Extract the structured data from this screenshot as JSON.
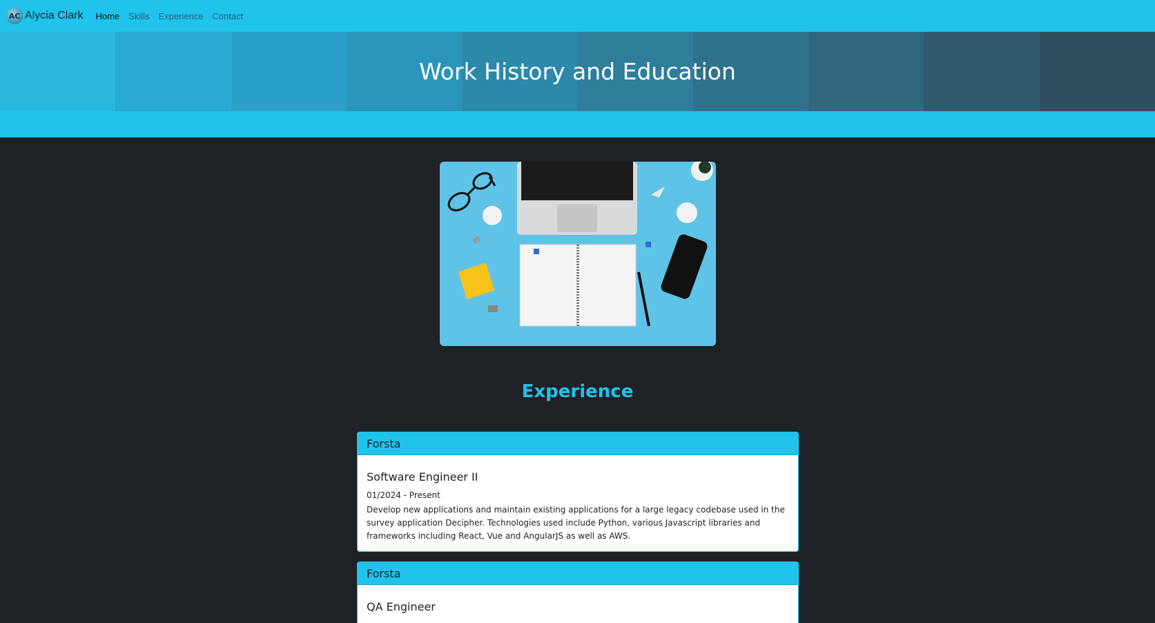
{
  "nav": {
    "brand_initials": "AC",
    "brand_name": "Alycia Clark",
    "links": [
      "Home",
      "Skills",
      "Experience",
      "Contact"
    ]
  },
  "hero": {
    "title": "Work History and Education",
    "band_colors": [
      "#2bb8df",
      "#2aaad3",
      "#2aa0c8",
      "#2a95ba",
      "#2c89aa",
      "#2e7e9c",
      "#2f728c",
      "#30677e",
      "#315a6d",
      "#324e5e"
    ]
  },
  "image": {
    "alt": "Desk with laptop, notebook and phone"
  },
  "experience": {
    "heading": "Experience",
    "jobs": [
      {
        "company": "Forsta",
        "title": "Software Engineer II",
        "dates": "01/2024 - Present",
        "description": "Develop new applications and maintain existing applications for a large legacy codebase used in the survey application Decipher. Technologies used include Python, various Javascript libraries and frameworks including React, Vue and AngularJS as well as AWS."
      },
      {
        "company": "Forsta",
        "title": "QA Engineer"
      }
    ]
  },
  "colors": {
    "accent": "#1fc3ec",
    "background": "#1e2125"
  }
}
